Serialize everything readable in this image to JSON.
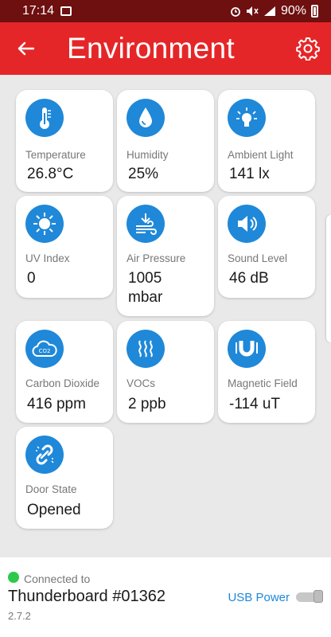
{
  "status_bar": {
    "time": "17:14",
    "battery": "90%"
  },
  "app_bar": {
    "title": "Environment"
  },
  "tiles": [
    {
      "label": "Temperature",
      "value": "26.8°C"
    },
    {
      "label": "Humidity",
      "value": "25%"
    },
    {
      "label": "Ambient Light",
      "value": "141 lx"
    },
    {
      "label": "UV Index",
      "value": "0"
    },
    {
      "label": "Air Pressure",
      "value": "1005",
      "value_line2": "mbar"
    },
    {
      "label": "Sound Level",
      "value": "46 dB"
    },
    {
      "label": "Carbon Dioxide",
      "value": "416 ppm",
      "icon_text": "CO2"
    },
    {
      "label": "VOCs",
      "value": "2 ppb"
    },
    {
      "label": "Magnetic Field",
      "value": "-114 uT"
    },
    {
      "label": "Door State",
      "value": "Opened"
    }
  ],
  "footer": {
    "connected_label": "Connected to",
    "device_name": "Thunderboard #01362",
    "version": "2.7.2",
    "power_label": "USB Power"
  },
  "colors": {
    "accent": "#e52628",
    "status_bar": "#6e0f10",
    "icon_bg": "#1f88d9",
    "connected_dot": "#2ec94c"
  }
}
